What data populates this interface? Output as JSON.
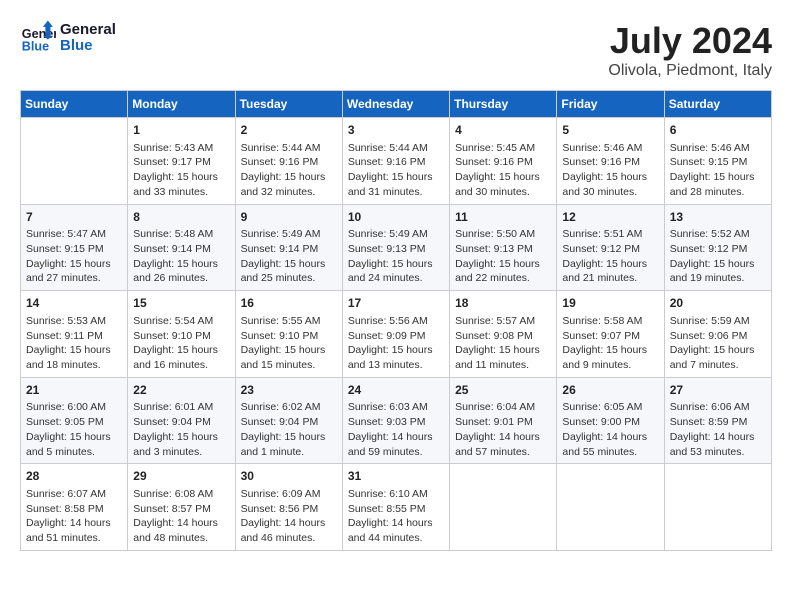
{
  "header": {
    "logo_line1": "General",
    "logo_line2": "Blue",
    "month_year": "July 2024",
    "location": "Olivola, Piedmont, Italy"
  },
  "days_of_week": [
    "Sunday",
    "Monday",
    "Tuesday",
    "Wednesday",
    "Thursday",
    "Friday",
    "Saturday"
  ],
  "weeks": [
    [
      {
        "day": null,
        "content": ""
      },
      {
        "day": "1",
        "content": "Sunrise: 5:43 AM\nSunset: 9:17 PM\nDaylight: 15 hours\nand 33 minutes."
      },
      {
        "day": "2",
        "content": "Sunrise: 5:44 AM\nSunset: 9:16 PM\nDaylight: 15 hours\nand 32 minutes."
      },
      {
        "day": "3",
        "content": "Sunrise: 5:44 AM\nSunset: 9:16 PM\nDaylight: 15 hours\nand 31 minutes."
      },
      {
        "day": "4",
        "content": "Sunrise: 5:45 AM\nSunset: 9:16 PM\nDaylight: 15 hours\nand 30 minutes."
      },
      {
        "day": "5",
        "content": "Sunrise: 5:46 AM\nSunset: 9:16 PM\nDaylight: 15 hours\nand 30 minutes."
      },
      {
        "day": "6",
        "content": "Sunrise: 5:46 AM\nSunset: 9:15 PM\nDaylight: 15 hours\nand 28 minutes."
      }
    ],
    [
      {
        "day": "7",
        "content": "Sunrise: 5:47 AM\nSunset: 9:15 PM\nDaylight: 15 hours\nand 27 minutes."
      },
      {
        "day": "8",
        "content": "Sunrise: 5:48 AM\nSunset: 9:14 PM\nDaylight: 15 hours\nand 26 minutes."
      },
      {
        "day": "9",
        "content": "Sunrise: 5:49 AM\nSunset: 9:14 PM\nDaylight: 15 hours\nand 25 minutes."
      },
      {
        "day": "10",
        "content": "Sunrise: 5:49 AM\nSunset: 9:13 PM\nDaylight: 15 hours\nand 24 minutes."
      },
      {
        "day": "11",
        "content": "Sunrise: 5:50 AM\nSunset: 9:13 PM\nDaylight: 15 hours\nand 22 minutes."
      },
      {
        "day": "12",
        "content": "Sunrise: 5:51 AM\nSunset: 9:12 PM\nDaylight: 15 hours\nand 21 minutes."
      },
      {
        "day": "13",
        "content": "Sunrise: 5:52 AM\nSunset: 9:12 PM\nDaylight: 15 hours\nand 19 minutes."
      }
    ],
    [
      {
        "day": "14",
        "content": "Sunrise: 5:53 AM\nSunset: 9:11 PM\nDaylight: 15 hours\nand 18 minutes."
      },
      {
        "day": "15",
        "content": "Sunrise: 5:54 AM\nSunset: 9:10 PM\nDaylight: 15 hours\nand 16 minutes."
      },
      {
        "day": "16",
        "content": "Sunrise: 5:55 AM\nSunset: 9:10 PM\nDaylight: 15 hours\nand 15 minutes."
      },
      {
        "day": "17",
        "content": "Sunrise: 5:56 AM\nSunset: 9:09 PM\nDaylight: 15 hours\nand 13 minutes."
      },
      {
        "day": "18",
        "content": "Sunrise: 5:57 AM\nSunset: 9:08 PM\nDaylight: 15 hours\nand 11 minutes."
      },
      {
        "day": "19",
        "content": "Sunrise: 5:58 AM\nSunset: 9:07 PM\nDaylight: 15 hours\nand 9 minutes."
      },
      {
        "day": "20",
        "content": "Sunrise: 5:59 AM\nSunset: 9:06 PM\nDaylight: 15 hours\nand 7 minutes."
      }
    ],
    [
      {
        "day": "21",
        "content": "Sunrise: 6:00 AM\nSunset: 9:05 PM\nDaylight: 15 hours\nand 5 minutes."
      },
      {
        "day": "22",
        "content": "Sunrise: 6:01 AM\nSunset: 9:04 PM\nDaylight: 15 hours\nand 3 minutes."
      },
      {
        "day": "23",
        "content": "Sunrise: 6:02 AM\nSunset: 9:04 PM\nDaylight: 15 hours\nand 1 minute."
      },
      {
        "day": "24",
        "content": "Sunrise: 6:03 AM\nSunset: 9:03 PM\nDaylight: 14 hours\nand 59 minutes."
      },
      {
        "day": "25",
        "content": "Sunrise: 6:04 AM\nSunset: 9:01 PM\nDaylight: 14 hours\nand 57 minutes."
      },
      {
        "day": "26",
        "content": "Sunrise: 6:05 AM\nSunset: 9:00 PM\nDaylight: 14 hours\nand 55 minutes."
      },
      {
        "day": "27",
        "content": "Sunrise: 6:06 AM\nSunset: 8:59 PM\nDaylight: 14 hours\nand 53 minutes."
      }
    ],
    [
      {
        "day": "28",
        "content": "Sunrise: 6:07 AM\nSunset: 8:58 PM\nDaylight: 14 hours\nand 51 minutes."
      },
      {
        "day": "29",
        "content": "Sunrise: 6:08 AM\nSunset: 8:57 PM\nDaylight: 14 hours\nand 48 minutes."
      },
      {
        "day": "30",
        "content": "Sunrise: 6:09 AM\nSunset: 8:56 PM\nDaylight: 14 hours\nand 46 minutes."
      },
      {
        "day": "31",
        "content": "Sunrise: 6:10 AM\nSunset: 8:55 PM\nDaylight: 14 hours\nand 44 minutes."
      },
      {
        "day": null,
        "content": ""
      },
      {
        "day": null,
        "content": ""
      },
      {
        "day": null,
        "content": ""
      }
    ]
  ]
}
